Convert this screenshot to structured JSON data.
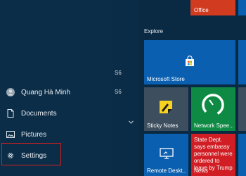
{
  "user": {
    "name": "Quang Hà Minh"
  },
  "nav": {
    "documents": "Documents",
    "pictures": "Pictures",
    "settings": "Settings"
  },
  "fragments": {
    "a": "S6",
    "b": "S6"
  },
  "group": {
    "label": "Explore"
  },
  "tiles": {
    "office": "Office",
    "store": "Microsoft Store",
    "sticky": "Sticky Notes",
    "network": "Network Spee...",
    "remote": "Remote Deskt...",
    "news_headline": "State Dept. says embassy personnel were ordered to leave by Trump",
    "news": "News"
  },
  "colors": {
    "tile_blue": "#0a5fb0",
    "tile_dark": "#3d4e5e",
    "network_green": "#0e8a44",
    "news_red": "#d01e24",
    "office_red": "#d13b20",
    "selection_red": "#d42020"
  }
}
